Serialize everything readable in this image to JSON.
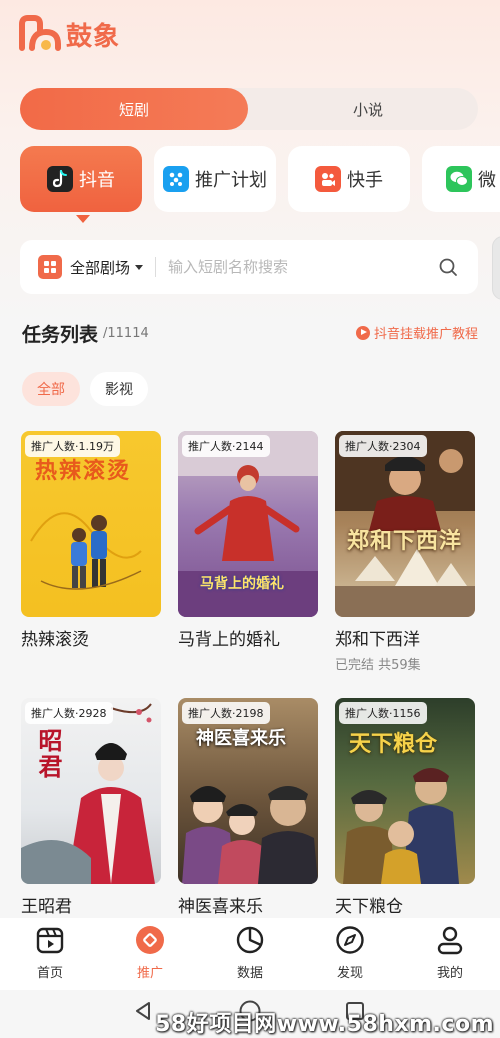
{
  "app": {
    "name": "鼓象"
  },
  "segment": {
    "tabs": [
      "短剧",
      "小说"
    ],
    "active": 0
  },
  "platforms": [
    {
      "label": "抖音",
      "icon": "douyin-icon"
    },
    {
      "label": "推广计划",
      "icon": "plan-icon"
    },
    {
      "label": "快手",
      "icon": "kuaishou-icon"
    },
    {
      "label": "微",
      "icon": "wechat-icon"
    }
  ],
  "search": {
    "category": "全部剧场",
    "placeholder": "输入短剧名称搜索"
  },
  "tasks": {
    "title": "任务列表",
    "count": "/11114",
    "tutorial": "抖音挂载推广教程"
  },
  "filters": [
    "全部",
    "影视"
  ],
  "dramas": [
    {
      "title": "热辣滚烫",
      "badge": "推广人数·1.19万",
      "sub": "",
      "poster_text": "热辣滚烫"
    },
    {
      "title": "马背上的婚礼",
      "badge": "推广人数·2144",
      "sub": "",
      "poster_text": "马背上的婚礼"
    },
    {
      "title": "郑和下西洋",
      "badge": "推广人数·2304",
      "sub": "已完结 共59集",
      "poster_text": "郑和下西洋"
    },
    {
      "title": "王昭君",
      "badge": "推广人数·2928",
      "sub": "",
      "poster_text": "昭君"
    },
    {
      "title": "神医喜来乐",
      "badge": "推广人数·2198",
      "sub": "",
      "poster_text": "神医喜来乐"
    },
    {
      "title": "天下粮仓",
      "badge": "推广人数·1156",
      "sub": "",
      "poster_text": "天下粮仓"
    }
  ],
  "tabbar": [
    {
      "label": "首页",
      "icon": "home-icon"
    },
    {
      "label": "推广",
      "icon": "promote-icon"
    },
    {
      "label": "数据",
      "icon": "data-icon"
    },
    {
      "label": "发现",
      "icon": "discover-icon"
    },
    {
      "label": "我的",
      "icon": "profile-icon"
    }
  ],
  "watermark": "58好项目网www.58hxm.com",
  "colors": {
    "accent": "#f06a4a",
    "background": "#f6f6f6"
  }
}
